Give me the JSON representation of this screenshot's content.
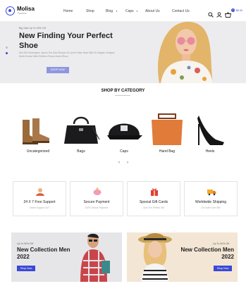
{
  "brand": {
    "name": "Molisa",
    "tagline": "Fashion"
  },
  "nav": [
    {
      "label": "Home"
    },
    {
      "label": "Shop"
    },
    {
      "label": "Blog"
    },
    {
      "label": "Caps"
    },
    {
      "label": "About Us"
    },
    {
      "label": "Contact Us"
    }
  ],
  "header": {
    "cart_count": "0",
    "cart_total": "$0.00"
  },
  "hero": {
    "subtitle": "Big Sale Up To 40% Off",
    "title": "New Finding Your Perfect Shoe",
    "description": "Nisl Elit Scelerisque Jacuis The Sed Semper Eu Amet Vitae Vitae Nibh Et Magnis Volutpat Nulla Ornare Nibh Eleifend Fauca Acma Risus",
    "button": "SHOP NOW"
  },
  "categories": {
    "title": "SHOP BY CATEGORY",
    "items": [
      {
        "label": "Uncategorized"
      },
      {
        "label": "Bags"
      },
      {
        "label": "Caps"
      },
      {
        "label": "Hand Bag"
      },
      {
        "label": "Heels"
      }
    ],
    "prev_arrow": "‹",
    "next_arrow": "›"
  },
  "features": [
    {
      "title": "24 X 7 Free Support",
      "subtitle": "Online Support 24/7",
      "icon": "support-person-icon"
    },
    {
      "title": "Secure Payment",
      "subtitle": "100% Secure Payment",
      "icon": "piggy-bank-icon"
    },
    {
      "title": "Special Gift Cards",
      "subtitle": "Give The Perfect Gift",
      "icon": "gift-box-icon"
    },
    {
      "title": "Worldwide Shipping",
      "subtitle": "On Order Over $99",
      "icon": "delivery-truck-icon"
    }
  ],
  "banners": [
    {
      "subtitle": "Up To 50% Off",
      "title": "New Collection Men 2022",
      "button": "Shop Now"
    },
    {
      "subtitle": "Up To 50% Off",
      "title": "New Collection Men 2022",
      "button": "Shop Now"
    }
  ],
  "colors": {
    "accent": "#3b49d6",
    "hero_bg": "#ececee",
    "banner_left_bg": "#e6e6e8",
    "banner_right_bg": "#f3e6d4"
  }
}
